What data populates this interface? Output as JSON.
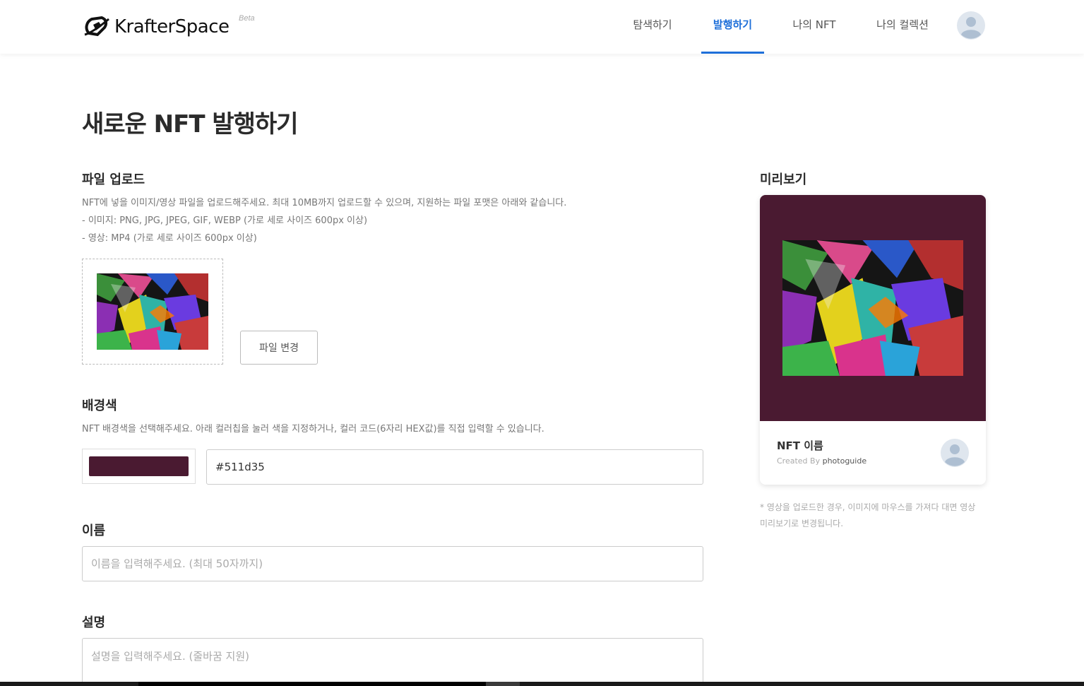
{
  "brand": {
    "name": "KrafterSpace",
    "badge": "Beta"
  },
  "nav": {
    "explore": "탐색하기",
    "mint": "발행하기",
    "my_nft": "나의 NFT",
    "my_collection": "나의 컬렉션"
  },
  "page": {
    "title": "새로운 NFT 발행하기"
  },
  "upload": {
    "label": "파일 업로드",
    "help_1": "NFT에 넣을 이미지/영상 파일을 업로드해주세요. 최대 10MB까지 업로드할 수 있으며, 지원하는 파일 포맷은 아래와 같습니다.",
    "help_2": "- 이미지: PNG, JPG, JPEG, GIF, WEBP (가로 세로 사이즈 600px 이상)",
    "help_3": "- 영상: MP4 (가로 세로 사이즈 600px 이상)",
    "change_button": "파일 변경"
  },
  "background": {
    "label": "배경색",
    "help": "NFT 배경색을 선택해주세요. 아래 컬러칩을 눌러 색을 지정하거나, 컬러 코드(6자리 HEX값)를 직접 입력할 수 있습니다.",
    "hex_value": "#511d35",
    "color": "#4a1a31"
  },
  "name": {
    "label": "이름",
    "placeholder": "이름을 입력해주세요. (최대 50자까지)"
  },
  "description": {
    "label": "설명",
    "placeholder": "설명을 입력해주세요. (줄바꿈 지원)"
  },
  "preview": {
    "label": "미리보기",
    "nft_name": "NFT 이름",
    "created_by": "Created By",
    "creator": "photoguide",
    "note": "* 영상을 업로드한 경우, 이미지에 마우스를 가져다 대면 영상 미리보기로 변경됩니다."
  },
  "icons": {
    "logo": "krafterspace-logo-icon",
    "avatar": "user-avatar-icon",
    "artwork": "leaf-artwork-image"
  }
}
